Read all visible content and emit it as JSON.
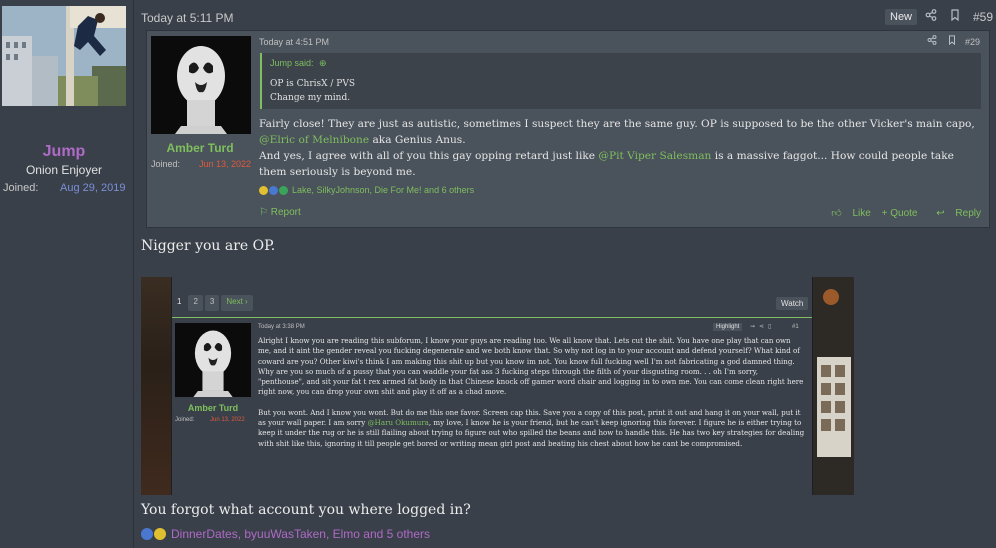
{
  "user": {
    "name": "Jump",
    "title": "Onion Enjoyer",
    "joined_label": "Joined:",
    "joined_date": "Aug 29, 2019"
  },
  "post": {
    "time": "Today at 5:11 PM",
    "new_badge": "New",
    "number": "#59",
    "share_icon": "share-icon",
    "bookmark_icon": "bookmark-icon"
  },
  "quote": {
    "author": "Amber Turd",
    "joined_label": "Joined:",
    "joined_date": "Jun 13, 2022",
    "time": "Today at 4:51 PM",
    "number": "#29",
    "inner": {
      "said": "Jump said:",
      "line1": "OP is ChrisX / PVS",
      "line2": "Change my mind."
    },
    "body_p1_a": "Fairly close! They are just as autistic, sometimes I suspect they are the same guy. OP is supposed to be the other Vicker's main capo, ",
    "body_p1_mention": "@Elric of Melnibone",
    "body_p1_b": " aka Genius Anus.",
    "body_p2_a": "And yes, I agree with all of you this gay opping retard just like ",
    "body_p2_mention": "@Pit Viper Salesman",
    "body_p2_b": " is a massive faggot... How could people take them seriously is beyond me.",
    "reactions_text": "Lake, SilkyJohnson, Die For Me! and 6 others",
    "report": "Report",
    "like": "Like",
    "quote_action": "+ Quote",
    "reply_action": "Reply"
  },
  "reply_text": "Nigger you are OP.",
  "screenshot": {
    "pages": [
      "1",
      "2",
      "3"
    ],
    "next": "Next ›",
    "watch": "Watch",
    "author": "Amber Turd",
    "joined_label": "Joined:",
    "joined_date": "Jun 13, 2022",
    "time": "Today at 3:38 PM",
    "highlight": "Highlight",
    "number": "#1",
    "p1": "Alright I know you are reading this subforum, I know your guys are reading too. We all know that. Lets cut the shit. You have one play that can own me, and it aint the gender reveal you fucking degenerate and we both know that. So why not log in to your account and defend yourself? What kind of coward are you? Other kiwi's think I am making this shit up but you know im not. You know full fucking well I'm not fabricating a god damned thing.",
    "p2": "Why are you so much of a pussy that you can waddle your fat ass 3 fucking steps through the filth of your disgusting room. . . oh I'm sorry, \"penthouse\", and sit your fat t rex armed fat body in that Chinese knock off gamer word chair and logging in to own me. You can come clean right here right now, you can drop your own shit and play it off as a chad move.",
    "p3_a": "But you wont. And I know you wont. But do me this one favor. Screen cap this. Save you a copy of this post, print it out and hang it on your wall, put it as your wall paper. I am sorry ",
    "p3_mention": "@Haru Okumura",
    "p3_b": ", my love, I know he is your friend, but he can't keep ignoring this forever. I figure he is either trying to keep it under the rug or he is still flailing about trying to figure out who spilled the beans and how to handle this. He has two key strategies for dealing with shit like this, ignoring it till people get bored or writing mean girl post and beating his chest about how he cant be compromised."
  },
  "reply2_text": "You forgot what account you where logged in?",
  "reactions2_text": "DinnerDates, byuuWasTaken, Elmo and 5 others"
}
